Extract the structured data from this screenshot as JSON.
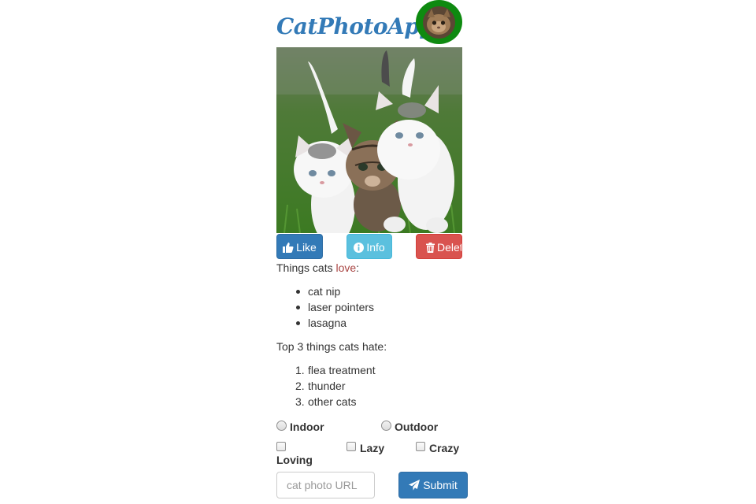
{
  "header": {
    "title": "CatPhotoApp"
  },
  "actions": {
    "like_label": "Like",
    "info_label": "Info",
    "delete_label": "Delete"
  },
  "loves": {
    "heading_prefix": "Things cats ",
    "heading_emphasis": "love",
    "heading_suffix": ":",
    "items": [
      "cat nip",
      "laser pointers",
      "lasagna"
    ]
  },
  "hates": {
    "heading": "Top 3 things cats hate:",
    "items": [
      "flea treatment",
      "thunder",
      "other cats"
    ]
  },
  "form": {
    "radios": [
      {
        "label": "Indoor",
        "checked": false
      },
      {
        "label": "Outdoor",
        "checked": false
      }
    ],
    "checkboxes": [
      {
        "label": "Loving",
        "checked": false
      },
      {
        "label": "Lazy",
        "checked": false
      },
      {
        "label": "Crazy",
        "checked": false
      }
    ],
    "url_placeholder": "cat photo URL",
    "submit_label": "Submit"
  },
  "colors": {
    "primary": "#337ab7",
    "info": "#5bc0de",
    "danger": "#d9534f",
    "avatar_border": "#0e8a10",
    "love_text": "#a94442"
  },
  "icons": {
    "like": "thumbs-up-icon",
    "info": "info-circle-icon",
    "delete": "trash-icon",
    "submit": "paper-plane-icon"
  }
}
